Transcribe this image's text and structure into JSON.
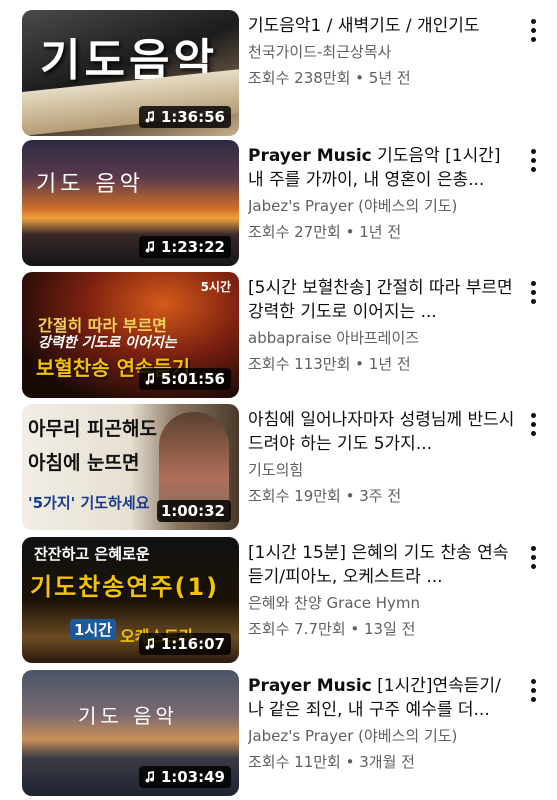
{
  "videos": [
    {
      "title": "기도음악1 / 새벽기도 / 개인기도",
      "title_bold": "",
      "channel": "천국가이드-최근상목사",
      "meta": "조회수 238만회 • 5년 전",
      "duration": "1:36:56",
      "thumb_text": "기도음악",
      "thumb_colors": [
        "#2a2a2a",
        "#7d6a55"
      ]
    },
    {
      "title": "기도음악 [1시간] 내 주를 가까이, 내 영혼이 은총...",
      "title_bold": "Prayer Music",
      "channel": "Jabez's Prayer (야베스의 기도)",
      "meta": "조회수 27만회 • 1년 전",
      "duration": "1:23:22",
      "thumb_text": "기도 음악",
      "thumb_colors": [
        "#3a2a3e",
        "#c86a2a"
      ]
    },
    {
      "title": "[5시간 보혈찬송] 간절히 따라 부르면 강력한 기도로 이어지는 ...",
      "title_bold": "",
      "channel": "abbapraise 아바프레이즈",
      "meta": "조회수 113만회 • 1년 전",
      "duration": "5:01:56",
      "thumb_lines": [
        "간절히 따라 부르면",
        "강력한 기도로 이어지는",
        "보혈찬송 연속듣기"
      ],
      "thumb_corner": "5시간",
      "thumb_colors": [
        "#1a0d08",
        "#a8351a"
      ]
    },
    {
      "title": "아침에 일어나자마자 성령님께 반드시 드려야 하는 기도 5가지...",
      "title_bold": "",
      "channel": "기도의힘",
      "meta": "조회수 19만회 • 3주 전",
      "duration": "1:00:32",
      "thumb_lines": [
        "아무리 피곤해도",
        "아침에 눈뜨면",
        "'5가지' 기도하세요"
      ],
      "thumb_colors": [
        "#e8e2d8",
        "#6b5a45"
      ]
    },
    {
      "title": "[1시간 15분] 은혜의 기도 찬송 연속듣기/피아노, 오케스트라 ...",
      "title_bold": "",
      "channel": "은혜와 찬양 Grace Hymn",
      "meta": "조회수 7.7만회 • 13일 전",
      "duration": "1:16:07",
      "thumb_lines": [
        "잔잔하고 은혜로운",
        "기도찬송연주(1)",
        "1시간",
        "오케스트라"
      ],
      "thumb_colors": [
        "#0d0d0d",
        "#3a2a1a"
      ]
    },
    {
      "title": "[1시간]연속듣기/ 나 같은 죄인, 내 구주 예수를 더...",
      "title_bold": "Prayer Music",
      "channel": "Jabez's Prayer (야베스의 기도)",
      "meta": "조회수 11만회 • 3개월 전",
      "duration": "1:03:49",
      "thumb_text": "기도 음악",
      "thumb_colors": [
        "#3d4a5e",
        "#c08a55"
      ]
    }
  ]
}
